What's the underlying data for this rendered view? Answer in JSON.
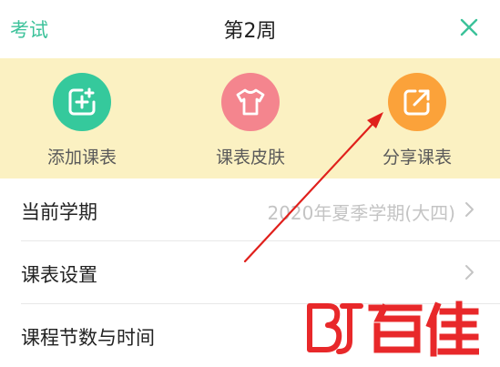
{
  "header": {
    "left_link": "考试",
    "title": "第2周",
    "close_icon": "close-icon"
  },
  "actions": [
    {
      "label": "添加课表",
      "icon": "add-schedule-icon",
      "color": "#35c99c"
    },
    {
      "label": "课表皮肤",
      "icon": "tshirt-icon",
      "color": "#f4858e"
    },
    {
      "label": "分享课表",
      "icon": "share-icon",
      "color": "#fba23a"
    }
  ],
  "settings": [
    {
      "label": "当前学期",
      "value": "2020年夏季学期(大四)"
    },
    {
      "label": "课表设置",
      "value": ""
    },
    {
      "label": "课程节数与时间",
      "value": ""
    }
  ],
  "colors": {
    "accent": "#3cc29a",
    "banner_bg": "#fbf1c2",
    "arrow": "#e0201c",
    "watermark": "#e8282a"
  },
  "watermark": {
    "icon": "bj-logo-icon",
    "text": "百佳"
  }
}
